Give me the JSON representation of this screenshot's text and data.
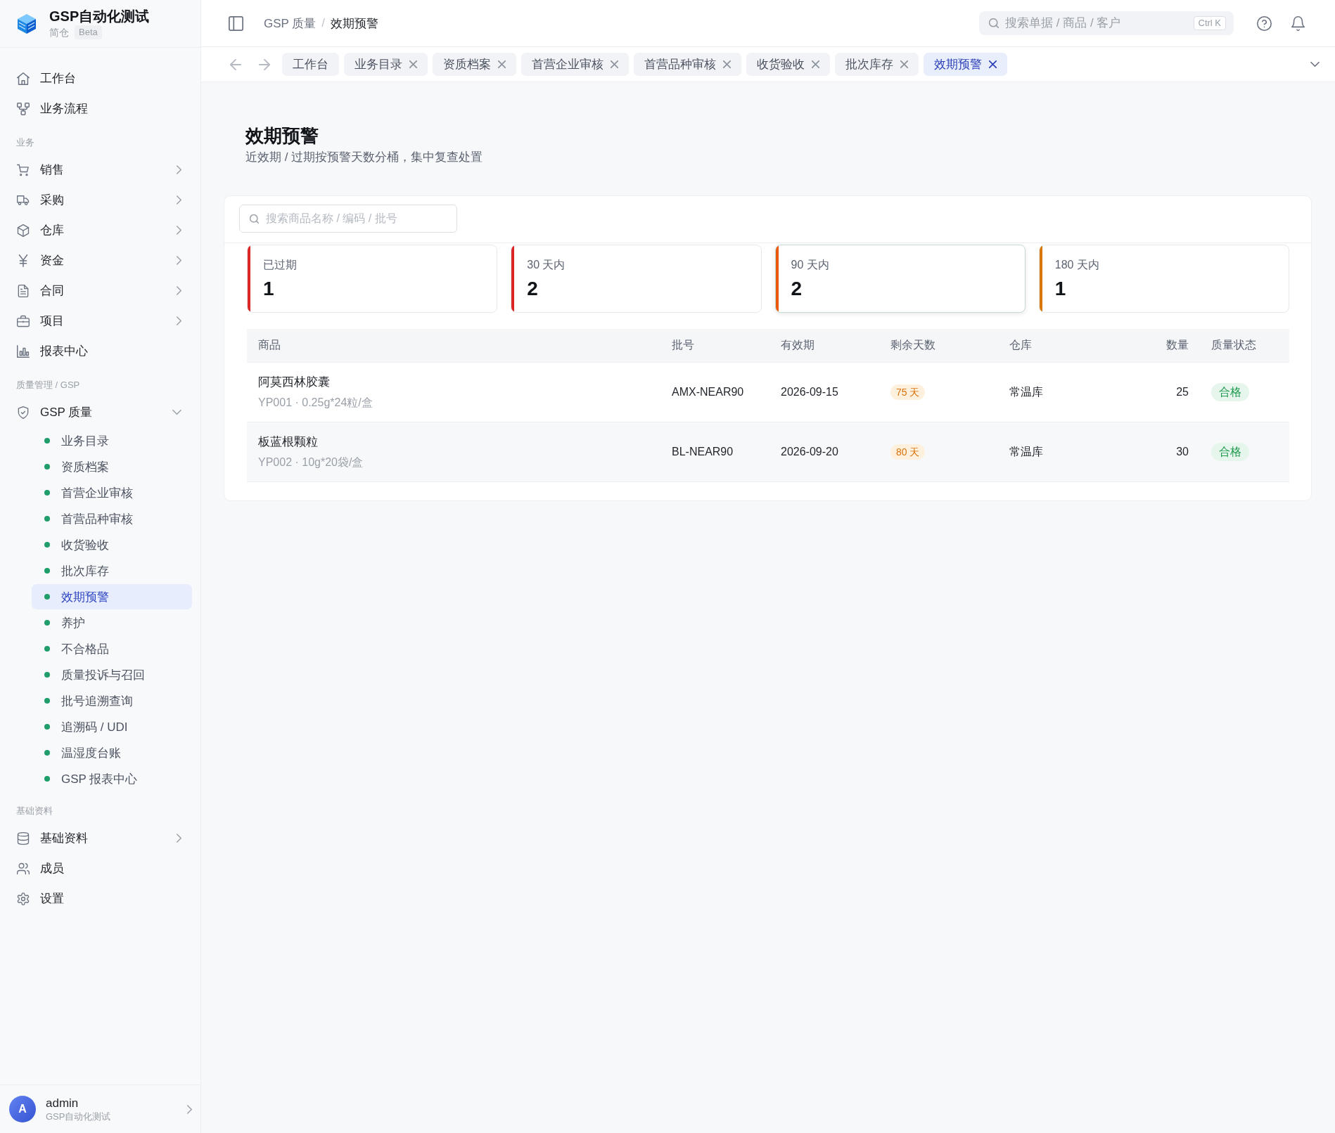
{
  "brand": {
    "title": "GSP自动化测试",
    "subtitle": "简仓",
    "badge": "Beta"
  },
  "sidebar": {
    "sections": [
      {
        "items": [
          {
            "label": "工作台",
            "kind": "link"
          },
          {
            "label": "业务流程",
            "kind": "link"
          }
        ]
      },
      {
        "title": "业务",
        "items": [
          {
            "label": "销售",
            "kind": "group",
            "expanded": false
          },
          {
            "label": "采购",
            "kind": "group",
            "expanded": false
          },
          {
            "label": "仓库",
            "kind": "group",
            "expanded": false
          },
          {
            "label": "资金",
            "kind": "group",
            "expanded": false
          },
          {
            "label": "合同",
            "kind": "group",
            "expanded": false
          },
          {
            "label": "项目",
            "kind": "group",
            "expanded": false
          },
          {
            "label": "报表中心",
            "kind": "link"
          }
        ]
      },
      {
        "title": "质量管理 / GSP",
        "items": [
          {
            "label": "GSP 质量",
            "kind": "group",
            "expanded": true,
            "children": [
              {
                "label": "业务目录",
                "selected": false
              },
              {
                "label": "资质档案",
                "selected": false
              },
              {
                "label": "首营企业审核",
                "selected": false
              },
              {
                "label": "首营品种审核",
                "selected": false
              },
              {
                "label": "收货验收",
                "selected": false
              },
              {
                "label": "批次库存",
                "selected": false
              },
              {
                "label": "效期预警",
                "selected": true
              },
              {
                "label": "养护",
                "selected": false
              },
              {
                "label": "不合格品",
                "selected": false
              },
              {
                "label": "质量投诉与召回",
                "selected": false
              },
              {
                "label": "批号追溯查询",
                "selected": false
              },
              {
                "label": "追溯码 / UDI",
                "selected": false
              },
              {
                "label": "温湿度台账",
                "selected": false
              },
              {
                "label": "GSP 报表中心",
                "selected": false
              }
            ]
          }
        ]
      },
      {
        "title": "基础资料",
        "items": [
          {
            "label": "基础资料",
            "kind": "group",
            "expanded": false
          },
          {
            "label": "成员",
            "kind": "link"
          },
          {
            "label": "设置",
            "kind": "link"
          }
        ]
      }
    ]
  },
  "user": {
    "initial": "A",
    "name": "admin",
    "org": "GSP自动化测试"
  },
  "topbar": {
    "breadcrumb": {
      "items": [
        "GSP 质量",
        "效期预警"
      ],
      "separator": "/"
    },
    "search": {
      "placeholder": "搜索单据 / 商品 / 客户",
      "shortcut": "Ctrl K"
    }
  },
  "tabs": [
    {
      "label": "工作台",
      "closable": false,
      "selected": false
    },
    {
      "label": "业务目录",
      "closable": true,
      "selected": false
    },
    {
      "label": "资质档案",
      "closable": true,
      "selected": false
    },
    {
      "label": "首营企业审核",
      "closable": true,
      "selected": false
    },
    {
      "label": "首营品种审核",
      "closable": true,
      "selected": false
    },
    {
      "label": "收货验收",
      "closable": true,
      "selected": false
    },
    {
      "label": "批次库存",
      "closable": true,
      "selected": false
    },
    {
      "label": "效期预警",
      "closable": true,
      "selected": true
    }
  ],
  "page": {
    "title": "效期预警",
    "subtitle": "近效期 / 过期按预警天数分桶，集中复查处置"
  },
  "filter": {
    "placeholder": "搜索商品名称 / 编码 / 批号"
  },
  "stats": [
    {
      "label": "已过期",
      "value": "1",
      "color": "#dc2626",
      "selected": false
    },
    {
      "label": "30 天内",
      "value": "2",
      "color": "#dc2626",
      "selected": false
    },
    {
      "label": "90 天内",
      "value": "2",
      "color": "#ea580c",
      "selected": true
    },
    {
      "label": "180 天内",
      "value": "1",
      "color": "#d97706",
      "selected": false
    }
  ],
  "table": {
    "columns": [
      {
        "label": "商品",
        "kind": "product"
      },
      {
        "label": "批号",
        "kind": "text"
      },
      {
        "label": "有效期",
        "kind": "text"
      },
      {
        "label": "剩余天数",
        "kind": "days"
      },
      {
        "label": "仓库",
        "kind": "text"
      },
      {
        "label": "数量",
        "kind": "number"
      },
      {
        "label": "质量状态",
        "kind": "status"
      }
    ],
    "rows": [
      {
        "cells": [
          {
            "name": "阿莫西林胶囊",
            "detail": "YP001 · 0.25g*24粒/盒"
          },
          "AMX-NEAR90",
          "2026-09-15",
          "75 天",
          "常温库",
          "25",
          "合格"
        ]
      },
      {
        "cells": [
          {
            "name": "板蓝根颗粒",
            "detail": "YP002 · 10g*20袋/盒"
          },
          "BL-NEAR90",
          "2026-09-20",
          "80 天",
          "常温库",
          "30",
          "合格"
        ]
      }
    ]
  }
}
